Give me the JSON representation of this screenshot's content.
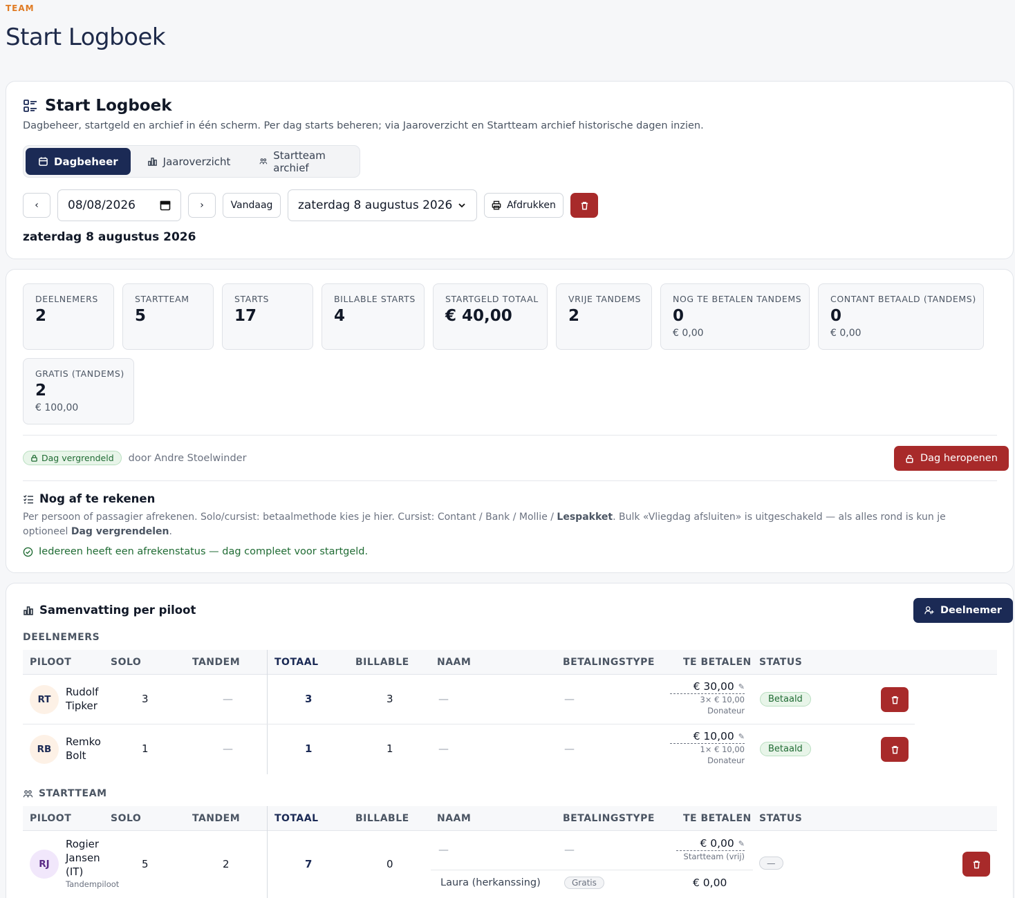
{
  "header": {
    "eyebrow": "TEAM",
    "title": "Start Logboek"
  },
  "card": {
    "title": "Start Logboek",
    "subtitle": "Dagbeheer, startgeld en archief in één scherm. Per dag starts beheren; via Jaaroverzicht en Startteam archief historische dagen inzien.",
    "tabs": [
      {
        "label": "Dagbeheer",
        "icon": "calendar-icon",
        "active": true
      },
      {
        "label": "Jaaroverzicht",
        "icon": "bar-chart-icon",
        "active": false
      },
      {
        "label": "Startteam archief",
        "icon": "users-icon",
        "active": false
      }
    ],
    "date_input": "08/08/2026",
    "today_label": "Vandaag",
    "date_select": "zaterdag 8 augustus 2026",
    "print_label": "Afdrukken",
    "date_heading": "zaterdag 8 augustus 2026"
  },
  "stats": [
    {
      "label": "DEELNEMERS",
      "value": "2"
    },
    {
      "label": "STARTTEAM",
      "value": "5"
    },
    {
      "label": "STARTS",
      "value": "17"
    },
    {
      "label": "BILLABLE STARTS",
      "value": "4"
    },
    {
      "label": "STARTGELD TOTAAL",
      "value": "€ 40,00"
    },
    {
      "label": "VRIJE TANDEMS",
      "value": "2"
    },
    {
      "label": "NOG TE BETALEN TANDEMS",
      "value": "0",
      "sub": "€ 0,00"
    },
    {
      "label": "CONTANT BETAALD (TANDEMS)",
      "value": "0",
      "sub": "€ 0,00"
    },
    {
      "label": "GRATIS (TANDEMS)",
      "value": "2",
      "sub": "€ 100,00"
    }
  ],
  "lock": {
    "badge": "Dag vergrendeld",
    "by": "door Andre Stoelwinder",
    "reopen_label": "Dag heropenen"
  },
  "settle": {
    "title": "Nog af te rekenen",
    "help_1": "Per persoon of passagier afrekenen. Solo/cursist: betaalmethode kies je hier. Cursist: Contant / Bank / Mollie / ",
    "help_bold_1": "Lespakket",
    "help_2": ". Bulk «Vliegdag afsluiten» is uitgeschakeld — als alles rond is kun je optioneel ",
    "help_bold_2": "Dag vergrendelen",
    "help_3": ".",
    "ok": "Iedereen heeft een afrekenstatus — dag compleet voor startgeld."
  },
  "summary": {
    "title": "Samenvatting per piloot",
    "add_label": "Deelnemer",
    "columns": [
      "PILOOT",
      "SOLO",
      "TANDEM",
      "TOTAAL",
      "BILLABLE",
      "NAAM",
      "BETALINGSTYPE",
      "TE BETALEN",
      "STATUS"
    ],
    "participants_label": "DEELNEMERS",
    "participants": [
      {
        "initials": "RT",
        "first": "Rudolf",
        "last": "Tipker",
        "solo": "3",
        "tandem": "—",
        "total": "3",
        "billable": "3",
        "name": "—",
        "paytype": "—",
        "amount": "€ 30,00",
        "calc": "3× € 10,00",
        "kind": "Donateur",
        "status": "Betaald"
      },
      {
        "initials": "RB",
        "first": "Remko",
        "last": "Bolt",
        "solo": "1",
        "tandem": "—",
        "total": "1",
        "billable": "1",
        "name": "—",
        "paytype": "—",
        "amount": "€ 10,00",
        "calc": "1× € 10,00",
        "kind": "Donateur",
        "status": "Betaald"
      }
    ],
    "team_label": "STARTTEAM",
    "team": [
      {
        "initials": "RJ",
        "line1": "Rogier",
        "line2": "Jansen",
        "line3": "(IT)",
        "role": "Tandempiloot",
        "solo": "5",
        "tandem": "2",
        "total": "7",
        "billable": "0",
        "name": "—",
        "paytype": "—",
        "amount": "€ 0,00",
        "kind": "Startteam (vrij)",
        "status": "—",
        "passenger": "Laura (herkanssing)",
        "passenger_type": "Gratis",
        "passenger_amount": "€ 0,00"
      }
    ]
  }
}
